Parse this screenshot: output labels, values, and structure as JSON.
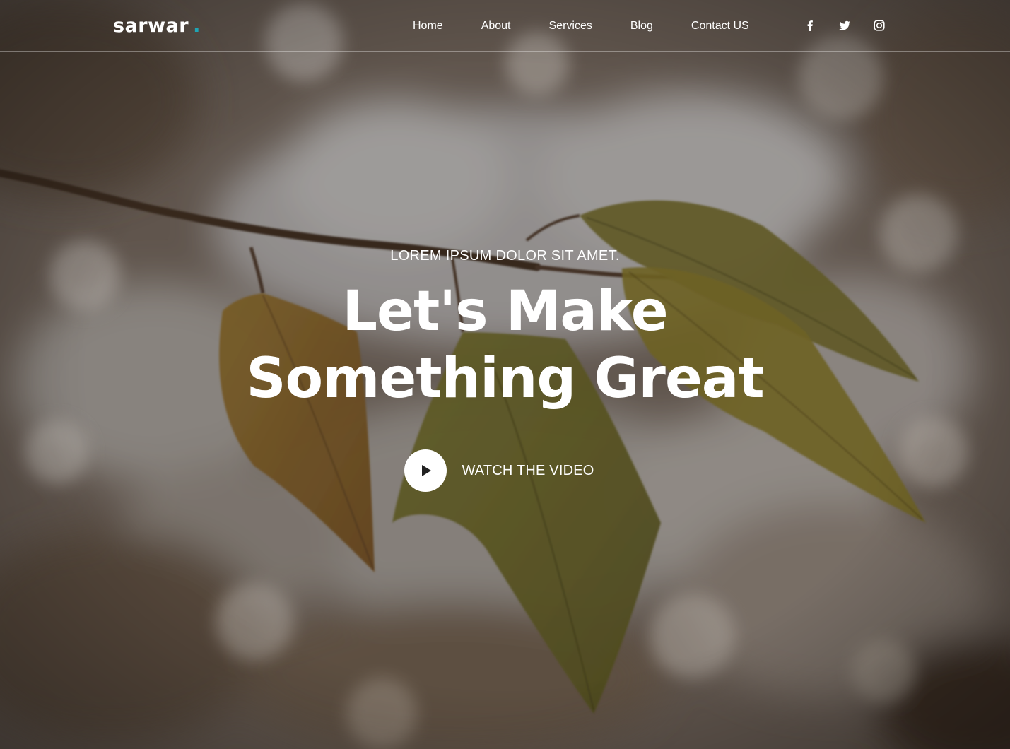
{
  "header": {
    "logo_text": "sarwar",
    "logo_dot": ".",
    "nav": {
      "home": "Home",
      "about": "About",
      "services": "Services",
      "blog": "Blog",
      "contact": "Contact US"
    },
    "social_icons": [
      "facebook-icon",
      "twitter-icon",
      "instagram-icon"
    ]
  },
  "hero": {
    "eyebrow": "LOREM IPSUM DOLOR SIT AMET.",
    "headline_line1": "Let's Make",
    "headline_line2": "Something Great",
    "cta_label": "WATCH THE VIDEO",
    "cta_icon": "play-icon"
  },
  "colors": {
    "accent": "#1ea4b4",
    "text": "#ffffff"
  }
}
